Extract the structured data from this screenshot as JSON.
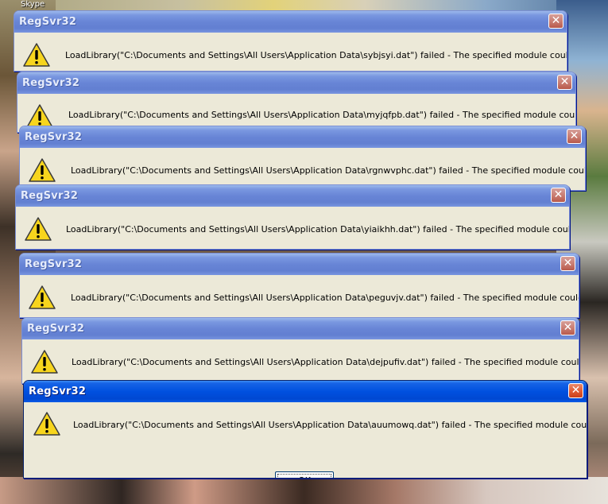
{
  "desktop": {
    "taskbar_label": "Skype"
  },
  "dialog_title": "RegSvr32",
  "close_glyph": "✕",
  "dialogs": [
    {
      "title": "RegSvr32",
      "message": "LoadLibrary(\"C:\\Documents and Settings\\All Users\\Application Data\\sybjsyi.dat\") failed - The specified module could not be found."
    },
    {
      "title": "RegSvr32",
      "message": "LoadLibrary(\"C:\\Documents and Settings\\All Users\\Application Data\\myjqfpb.dat\") failed - The specified module could not be found."
    },
    {
      "title": "RegSvr32",
      "message": "LoadLibrary(\"C:\\Documents and Settings\\All Users\\Application Data\\rgnwvphc.dat\") failed - The specified module could not be found."
    },
    {
      "title": "RegSvr32",
      "message": "LoadLibrary(\"C:\\Documents and Settings\\All Users\\Application Data\\yiaikhh.dat\") failed - The specified module could not be found."
    },
    {
      "title": "RegSvr32",
      "message": "LoadLibrary(\"C:\\Documents and Settings\\All Users\\Application Data\\peguvjv.dat\") failed - The specified module could not be found."
    },
    {
      "title": "RegSvr32",
      "message": "LoadLibrary(\"C:\\Documents and Settings\\All Users\\Application Data\\dejpufiv.dat\") failed - The specified module could not be found."
    },
    {
      "title": "RegSvr32",
      "message": "LoadLibrary(\"C:\\Documents and Settings\\All Users\\Application Data\\auumowq.dat\") failed - The specified module could not be found.",
      "ok_label": "OK"
    }
  ],
  "icons": {
    "dialog": "warning-icon",
    "close": "close-icon"
  },
  "colors": {
    "active_title": "#0050df",
    "inactive_title": "#6885d6",
    "dialog_bg": "#ece9d8",
    "close_button": "#e05a32"
  }
}
